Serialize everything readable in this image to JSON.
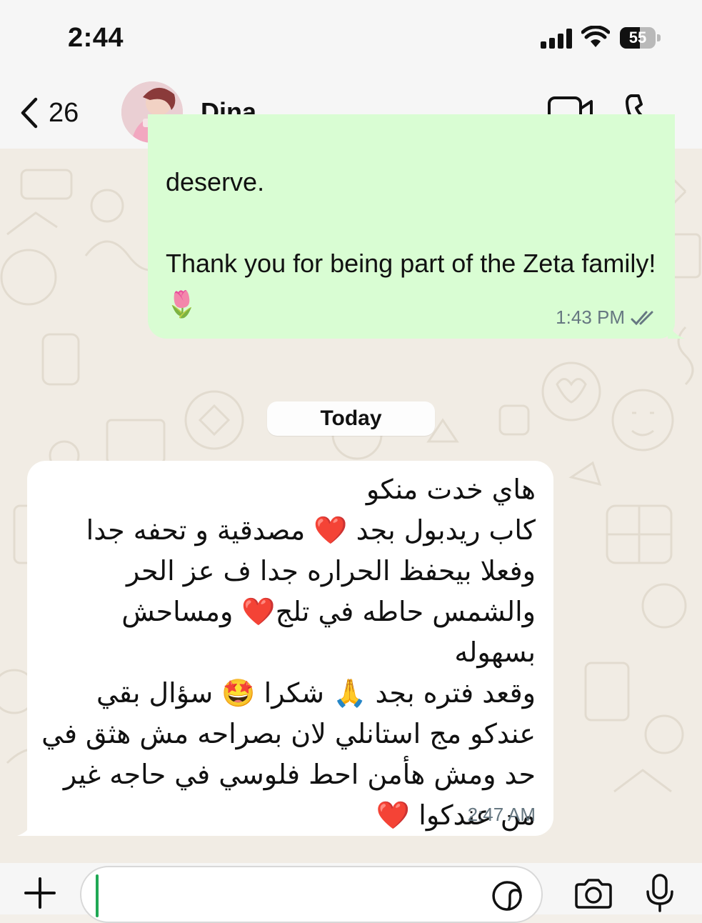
{
  "status_bar": {
    "time": "2:44",
    "battery_level": "55",
    "battery_fraction": 0.55
  },
  "header": {
    "back_count": "26",
    "contact_name": "Dina"
  },
  "messages": {
    "outgoing": {
      "text": "deserve.\n\nThank you for being part of the Zeta family! 🌷",
      "time": "1:43 PM",
      "status": "read"
    },
    "date_separator": "Today",
    "incoming": {
      "lines": [
        "هاي خدت منكو",
        "كاب ريدبول بجد ❤️ مصدقية و تحفه جدا",
        "وفعلا بيحفظ الحراره جدا ف عز الحر",
        "والشمس حاطه في تلج❤️ ومساحش بسهوله",
        "وقعد فتره بجد 🙏 شكرا 🤩 سؤال بقي",
        "عندكو مج استانلي لان بصراحه مش هثق في",
        "حد ومش هأمن احط فلوسي في حاجه غير",
        "من عندكوا ❤️"
      ],
      "time": "2:47 AM"
    }
  },
  "icons": [
    "chevron-left-icon",
    "video-icon",
    "phone-icon",
    "plus-icon",
    "sticker-icon",
    "camera-icon",
    "microphone-icon",
    "double-check-icon"
  ],
  "colors": {
    "outgoing_bubble": "#d9fdd3",
    "incoming_bubble": "#ffffff",
    "read_ticks": "#667781",
    "caret": "#1fa855"
  }
}
